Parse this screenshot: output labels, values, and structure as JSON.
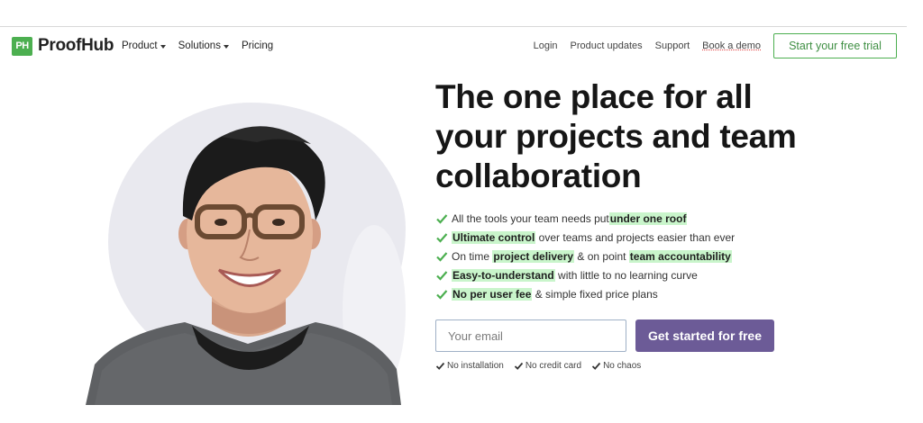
{
  "brand": {
    "mark": "PH",
    "name": "ProofHub"
  },
  "nav_left": [
    {
      "label": "Product",
      "has_caret": true
    },
    {
      "label": "Solutions",
      "has_caret": true
    },
    {
      "label": "Pricing",
      "has_caret": false
    }
  ],
  "nav_right": [
    "Login",
    "Product updates",
    "Support",
    "Book a demo"
  ],
  "header_cta": "Start your free trial",
  "hero": {
    "headline": "The one place for all your projects and team collaboration",
    "features": [
      {
        "before": "All the tools your team needs put ",
        "highlight": "under one roof",
        "after": "",
        "highlight2": "",
        "after2": ""
      },
      {
        "before": "",
        "highlight": "Ultimate control",
        "after": " over teams and projects easier than ever",
        "highlight2": "",
        "after2": ""
      },
      {
        "before": "On time ",
        "highlight": "project delivery",
        "after": " & on point ",
        "highlight2": "team accountability",
        "after2": ""
      },
      {
        "before": "",
        "highlight": "Easy-to-understand",
        "after": " with little to no learning curve",
        "highlight2": "",
        "after2": ""
      },
      {
        "before": "",
        "highlight": "No per user fee",
        "after": " & simple fixed price plans",
        "highlight2": "",
        "after2": ""
      }
    ],
    "email_placeholder": "Your email",
    "cta": "Get started for free",
    "small_points": [
      "No installation",
      "No credit card",
      "No chaos"
    ]
  },
  "colors": {
    "accent_green": "#4caf50",
    "cta_purple": "#6c5b97",
    "highlight": "#c9f5cb"
  }
}
